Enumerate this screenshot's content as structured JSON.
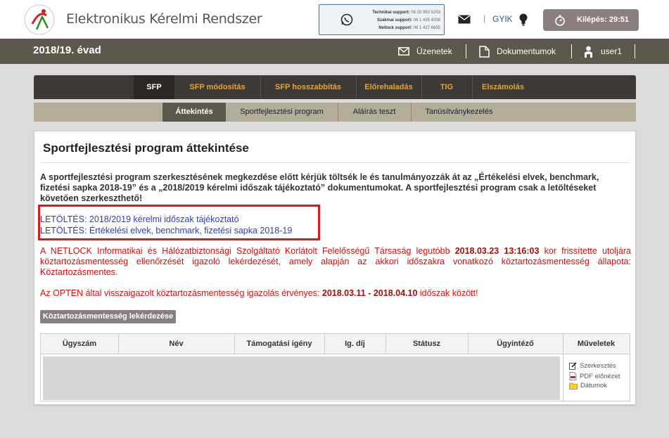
{
  "header": {
    "app_title": "Elektronikus Kérelmi Rendszer",
    "support": [
      {
        "label": "Technikai support:",
        "number": "06 20 993 5253"
      },
      {
        "label": "Szakmai support:",
        "number": "06 1 435 4258"
      },
      {
        "label": "Netlock support:",
        "number": "06 1 437 6655"
      }
    ],
    "separator": "|",
    "faq_label": "GYIK",
    "logout_label": "Kilépés: 29:51"
  },
  "season_bar": {
    "season": "2018/19. évad",
    "messages_label": "Üzenetek",
    "documents_label": "Dokumentumok",
    "user_label": "user1"
  },
  "main_tabs": [
    {
      "label": "SFP",
      "active": true
    },
    {
      "label": "SFP módosítás",
      "active": false
    },
    {
      "label": "SFP hosszabbítás",
      "active": false
    },
    {
      "label": "Előrehaladás",
      "active": false
    },
    {
      "label": "TIG",
      "active": false
    },
    {
      "label": "Elszámolás",
      "active": false
    }
  ],
  "sub_tabs": [
    {
      "label": "Áttekintés",
      "active": true
    },
    {
      "label": "Sportfejlesztési program",
      "active": false
    },
    {
      "label": "Aláírás teszt",
      "active": false
    },
    {
      "label": "Tanúsítványkezelés",
      "active": false
    }
  ],
  "content": {
    "title": "Sportfejlesztési program áttekintése",
    "intro": "A sportfejlesztési program szerkesztésének megkezdése előtt kérjük töltsék le és tanulmányozzák át az „Értékelési elvek, benchmark, fizetési sapka 2018-19” és a „2018/2019 kérelmi időszak tájékoztató” dokumentumokat. A sportfejlesztési program csak a letöltéseket követően szerkeszthető!",
    "download_1": "LETÖLTÉS: 2018/2019 kérelmi időszak tájékoztató",
    "download_2": "LETÖLTÉS: Értékelési elvek, benchmark, fizetési sapka 2018-19",
    "netlock_pre": "A NETLOCK Informatikai és Hálózatbiztonsági Szolgáltató Korlátolt Felelősségű Társaság legutóbb ",
    "netlock_date": "2018.03.23 13:16:03",
    "netlock_post": " kor frissítette utoljára köztartozásmentesség ellenőrzését igazoló lekérdezését, amely alapján az akkori időszakra vonatkozó köztartozásmentesség állapota: Köztartozásmentes.",
    "opten_pre": "Az OPTEN által visszaigazolt köztartozásmentesség igazolás érvényes: ",
    "opten_from": "2018.03.11",
    "opten_dash": " - ",
    "opten_to": "2018.04.10",
    "opten_post": " időszak között!",
    "query_button": "Köztartozásmentesség lekérdezése"
  },
  "table": {
    "columns": [
      "Ügyszám",
      "Név",
      "Támogatási igény",
      "Ig. díj",
      "Státusz",
      "Ügyintéző",
      "Műveletek"
    ],
    "actions": [
      {
        "label": "Szerkesztés",
        "icon": "edit-icon"
      },
      {
        "label": "PDF előnézet",
        "icon": "pdf-icon"
      },
      {
        "label": "Dátumok",
        "icon": "folder-icon"
      }
    ]
  },
  "colors": {
    "tab_orange": "#e8a431",
    "dark_bar": "#5c574f",
    "alert_red": "#d01010",
    "link_blue": "#2b3fb0",
    "highlight_box": "#cc1f1f"
  }
}
